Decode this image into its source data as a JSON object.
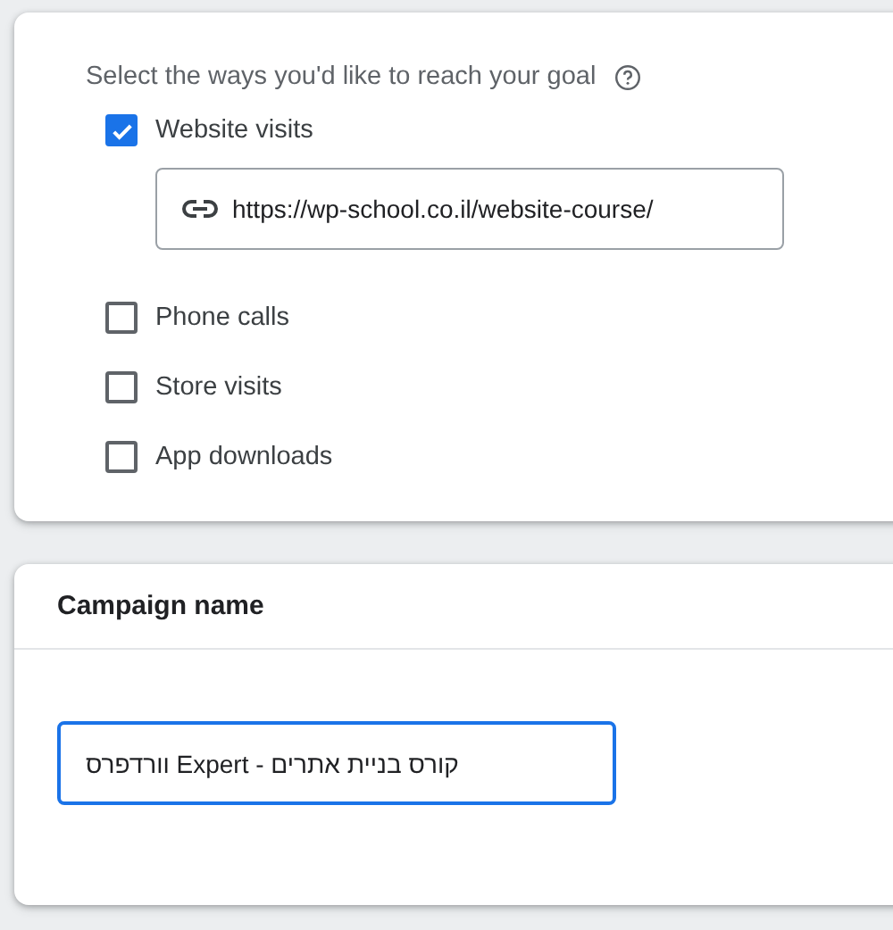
{
  "goal_card": {
    "heading": "Select the ways you'd like to reach your goal",
    "options": [
      {
        "label": "Website visits",
        "checked": true,
        "url": "https://wp-school.co.il/website-course/"
      },
      {
        "label": "Phone calls",
        "checked": false
      },
      {
        "label": "Store visits",
        "checked": false
      },
      {
        "label": "App downloads",
        "checked": false
      }
    ]
  },
  "campaign_card": {
    "title": "Campaign name",
    "value": "קורס בניית אתרים - Expert וורדפרס"
  }
}
